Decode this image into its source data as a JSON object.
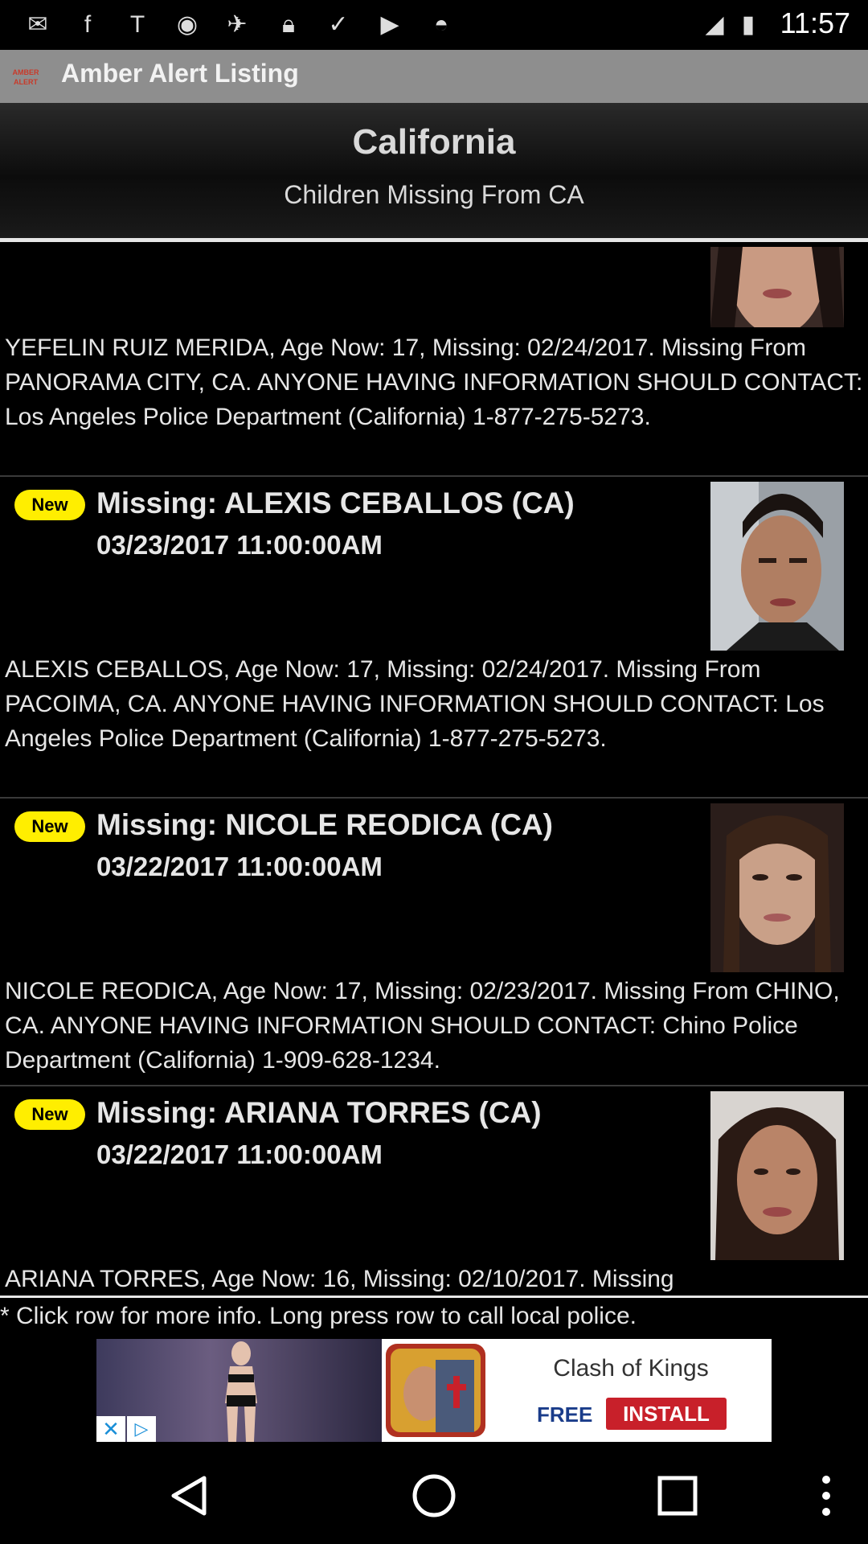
{
  "status_bar": {
    "time": "11:57",
    "icons": [
      "mail-icon",
      "facebook-icon",
      "text-icon",
      "sync-icon",
      "fake-gps-icon",
      "lock-icon",
      "inbox-icon",
      "briefcase-icon",
      "android-icon",
      "signal-icon",
      "battery-icon"
    ]
  },
  "app_bar": {
    "logo_text": "AMBER ALERT",
    "title": "Amber Alert Listing"
  },
  "header": {
    "region": "California",
    "subtitle": "Children Missing From CA"
  },
  "listings": [
    {
      "description": "YEFELIN RUIZ MERIDA, Age Now: 17, Missing: 02/24/2017. Missing From PANORAMA CITY, CA. ANYONE HAVING INFORMATION SHOULD CONTACT: Los Angeles Police Department  (California)  1-877-275-5273."
    },
    {
      "badge": "New",
      "title": "Missing: ALEXIS CEBALLOS (CA)",
      "date": "03/23/2017 11:00:00AM",
      "description": "ALEXIS CEBALLOS, Age Now: 17, Missing: 02/24/2017. Missing From PACOIMA, CA. ANYONE HAVING INFORMATION SHOULD CONTACT: Los Angeles Police Department  (California) 1-877-275-5273."
    },
    {
      "badge": "New",
      "title": "Missing: NICOLE REODICA (CA)",
      "date": "03/22/2017 11:00:00AM",
      "description": "NICOLE REODICA, Age Now: 17, Missing: 02/23/2017. Missing From CHINO, CA. ANYONE HAVING INFORMATION SHOULD CONTACT: Chino Police Department (California) 1-909-628-1234."
    },
    {
      "badge": "New",
      "title": "Missing: ARIANA TORRES (CA)",
      "date": "03/22/2017 11:00:00AM",
      "description": "ARIANA TORRES, Age Now: 16, Missing: 02/10/2017. Missing"
    }
  ],
  "footer": {
    "note": "* Click row for more info. Long press row to call local police."
  },
  "ad": {
    "game_title": "Clash of Kings",
    "free_label": "FREE",
    "install_label": "INSTALL",
    "close_symbol": "✕",
    "adchoices_symbol": "▷"
  },
  "colors": {
    "title_bar": "#8e8e8e",
    "new_badge": "#ffee00",
    "install_button": "#c8202a"
  }
}
